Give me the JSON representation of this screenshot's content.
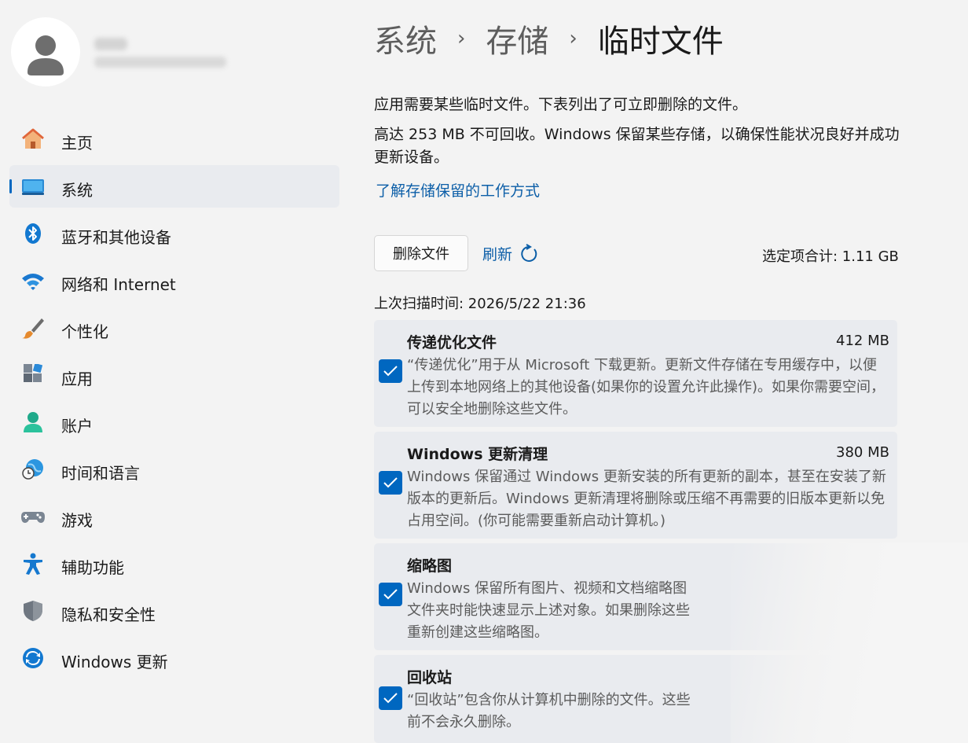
{
  "account": {
    "name": "",
    "email": ""
  },
  "nav": [
    {
      "label": "主页",
      "icon": "home-icon",
      "selected": false
    },
    {
      "label": "系统",
      "icon": "system-display-icon",
      "selected": true
    },
    {
      "label": "蓝牙和其他设备",
      "icon": "bluetooth-icon",
      "selected": false
    },
    {
      "label": "网络和 Internet",
      "icon": "wifi-icon",
      "selected": false
    },
    {
      "label": "个性化",
      "icon": "brush-icon",
      "selected": false
    },
    {
      "label": "应用",
      "icon": "apps-icon",
      "selected": false
    },
    {
      "label": "账户",
      "icon": "account-icon",
      "selected": false
    },
    {
      "label": "时间和语言",
      "icon": "globe-clock-icon",
      "selected": false
    },
    {
      "label": "游戏",
      "icon": "gamepad-icon",
      "selected": false
    },
    {
      "label": "辅助功能",
      "icon": "accessibility-icon",
      "selected": false
    },
    {
      "label": "隐私和安全性",
      "icon": "shield-icon",
      "selected": false
    },
    {
      "label": "Windows 更新",
      "icon": "windows-update-icon",
      "selected": false
    }
  ],
  "breadcrumb": {
    "level1": "系统",
    "level2": "存储",
    "current": "临时文件",
    "separator": "›"
  },
  "description": {
    "line1": "应用需要某些临时文件。下表列出了可立即删除的文件。",
    "line2": "高达 253 MB 不可回收。Windows 保留某些存储，以确保性能状况良好并成功更新设备。",
    "link": "了解存储保留的工作方式"
  },
  "toolbar": {
    "delete_label": "删除文件",
    "refresh_label": "刷新",
    "total_text": "选定项合计: 1.11 GB"
  },
  "scan_time": "上次扫描时间: 2026/5/22 21:36",
  "items": [
    {
      "title": "传递优化文件",
      "size": "412 MB",
      "checked": true,
      "desc": "“传递优化”用于从 Microsoft 下载更新。更新文件存储在专用缓存中，以便上传到本地网络上的其他设备(如果你的设置允许此操作)。如果你需要空间，可以安全地删除这些文件。"
    },
    {
      "title": "Windows 更新清理",
      "size": "380 MB",
      "checked": true,
      "desc": "Windows 保留通过 Windows 更新安装的所有更新的副本，甚至在安装了新版本的更新后。Windows 更新清理将删除或压缩不再需要的旧版本更新以免占用空间。(你可能需要重新启动计算机。)"
    },
    {
      "title": "缩略图",
      "size": "",
      "checked": true,
      "desc": "Windows 保留所有图片、视频和文档缩略图\n文件夹时能快速显示上述对象。如果删除这些\n重新创建这些缩略图。"
    },
    {
      "title": "回收站",
      "size": "",
      "checked": true,
      "desc": "“回收站”包含你从计算机中删除的文件。这些\n前不会永久删除。"
    }
  ],
  "colors": {
    "accent": "#0067c0",
    "link": "#0d5fa8",
    "background": "#f3f3f3",
    "card": "#e9ebef"
  }
}
